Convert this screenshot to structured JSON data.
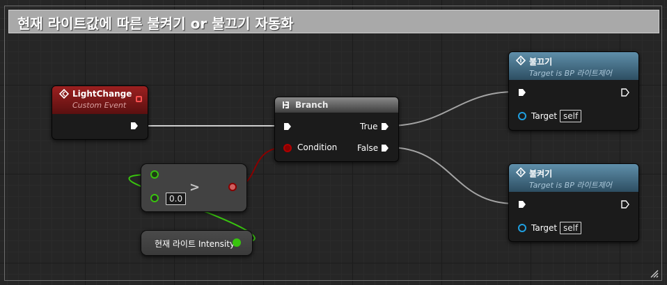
{
  "comment": {
    "title": "현재 라이트값에 따른 불켜기 or 불끄기 자동화"
  },
  "nodes": {
    "light_change": {
      "title": "LightChange",
      "subtitle": "Custom Event",
      "icon": "event-diamond-icon"
    },
    "branch": {
      "title": "Branch",
      "icon": "branch-icon",
      "true_label": "True",
      "false_label": "False",
      "condition_label": "Condition"
    },
    "compare": {
      "operator": ">",
      "b_value": "0.0"
    },
    "intensity_var": {
      "label": "현재 라이트 Intensity"
    },
    "turn_off": {
      "title": "불끄기",
      "subtitle": "Target is BP 라이트제어",
      "target_label": "Target",
      "target_value": "self",
      "icon": "function-icon"
    },
    "turn_on": {
      "title": "불켜기",
      "subtitle": "Target is BP 라이트제어",
      "target_label": "Target",
      "target_value": "self",
      "icon": "function-icon"
    }
  },
  "colors": {
    "event_header": "#8f1a1a",
    "function_header": "#4d7d99",
    "exec_wire": "#d0d0d0",
    "bool_pin": "#8a0000",
    "float_pin": "#39c40f",
    "object_pin": "#1f9fe0"
  }
}
